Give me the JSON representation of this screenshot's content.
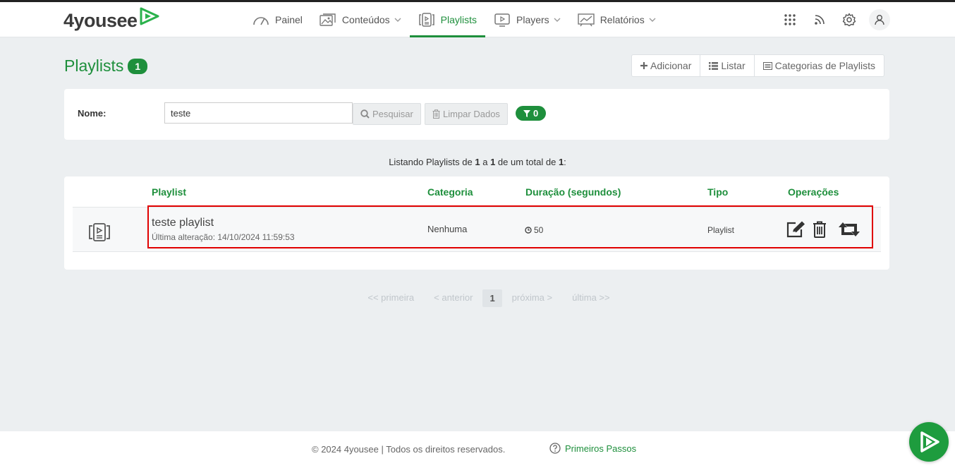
{
  "brand": {
    "name": "4yousee",
    "accent": "#1e8f3c"
  },
  "nav": {
    "painel": "Painel",
    "conteudos": "Conteúdos",
    "playlists": "Playlists",
    "players": "Players",
    "relatorios": "Relatórios"
  },
  "header_icons": [
    "apps-grid-icon",
    "rss-icon",
    "gear-icon",
    "user-icon"
  ],
  "page": {
    "title": "Playlists",
    "count": "1",
    "actions": {
      "add": "Adicionar",
      "list": "Listar",
      "categories": "Categorias de Playlists"
    }
  },
  "search": {
    "label": "Nome:",
    "value": "teste",
    "search_button": "Pesquisar",
    "clear_button": "Limpar Dados",
    "filter_count": "0"
  },
  "listing": {
    "prefix": "Listando Playlists de",
    "from": "1",
    "a": "a",
    "to": "1",
    "total_text": "de um total de",
    "total": "1",
    "suffix": ":"
  },
  "table": {
    "headers": {
      "playlist": "Playlist",
      "categoria": "Categoria",
      "duracao": "Duração (segundos)",
      "tipo": "Tipo",
      "operacoes": "Operações"
    },
    "rows": [
      {
        "name": "teste playlist",
        "updated": "Última alteração: 14/10/2024 11:59:53",
        "category": "Nenhuma",
        "duration": "50",
        "type": "Playlist"
      }
    ]
  },
  "pagination": {
    "first": "<< primeira",
    "prev": "< anterior",
    "current": "1",
    "next": "próxima >",
    "last": "última >>"
  },
  "footer": {
    "copyright": "© 2024 4yousee | Todos os direitos reservados.",
    "link": "Primeiros Passos"
  }
}
